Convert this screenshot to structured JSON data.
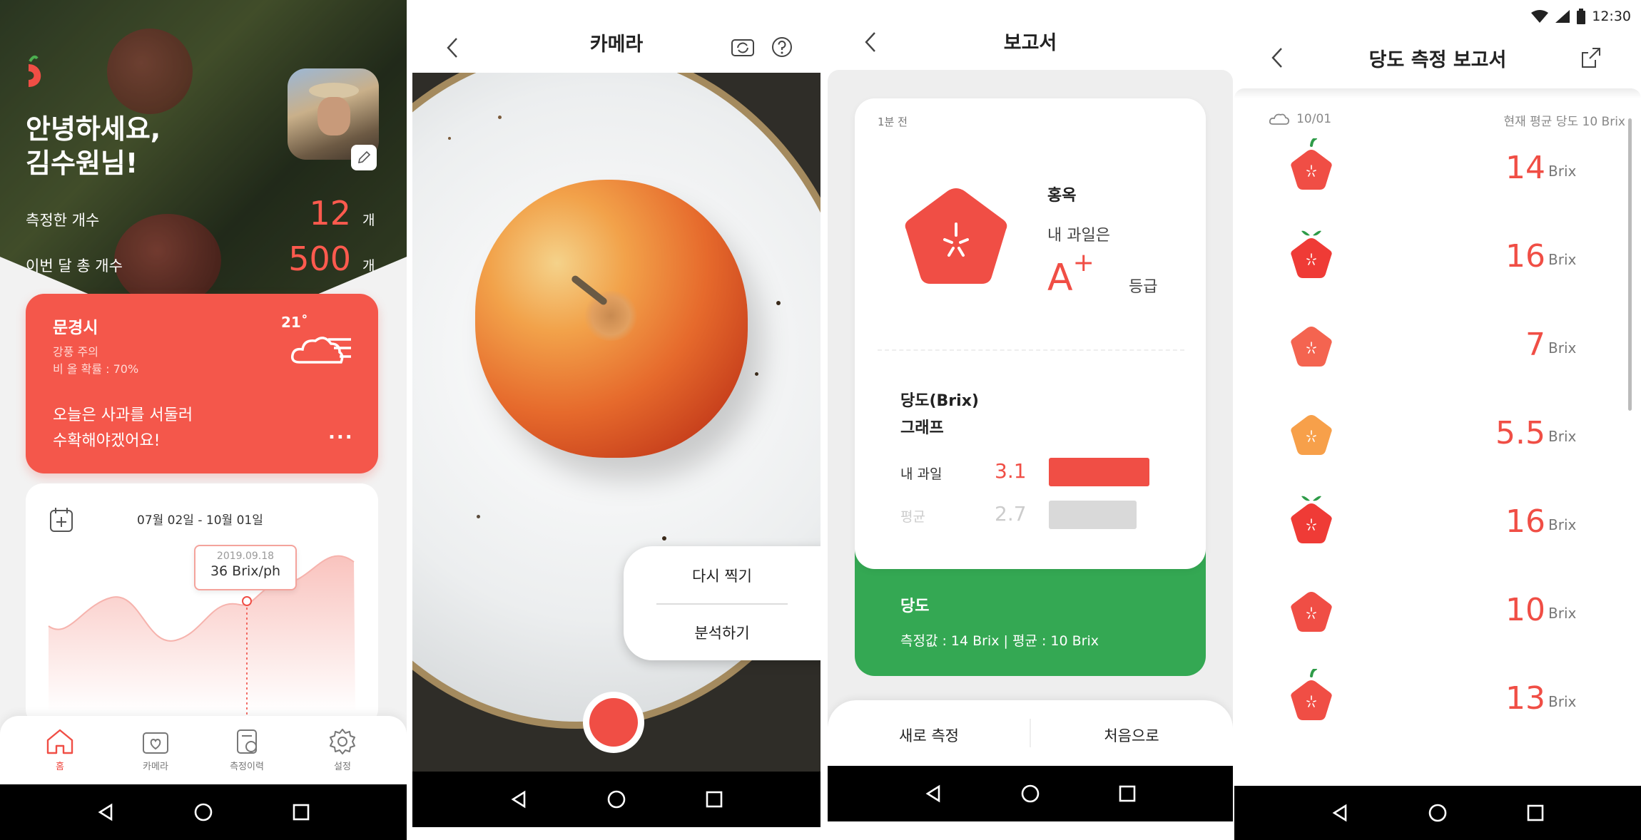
{
  "home": {
    "greeting_line1": "안녕하세요,",
    "greeting_line2": "김수원님!",
    "stats": [
      {
        "label": "측정한 개수",
        "value": "12",
        "unit": "개"
      },
      {
        "label": "이번 달 총 개수",
        "value": "500",
        "unit": "개"
      }
    ],
    "weather": {
      "city": "문경시",
      "temp": "21˚",
      "warning": "강풍 주의",
      "rain": "비 올 확률 : 70%",
      "message_line1": "오늘은 사과를 서둘러",
      "message_line2": "수확해야겠어요!",
      "more": "..."
    },
    "chart_card": {
      "date_range": "07월 02일 - 10월 01일",
      "tooltip_date": "2019.09.18",
      "tooltip_value": "36 Brix/ph"
    },
    "tabs": [
      {
        "label": "홈",
        "icon": "home-icon"
      },
      {
        "label": "카메라",
        "icon": "camera-icon"
      },
      {
        "label": "측정이력",
        "icon": "history-icon"
      },
      {
        "label": "설정",
        "icon": "gear-icon"
      }
    ]
  },
  "camera": {
    "title": "카메라",
    "retake": "다시 찍기",
    "analyze": "분석하기"
  },
  "report": {
    "title": "보고서",
    "time_ago": "1분 전",
    "variety": "홍옥",
    "my_fruit_is": "내 과일은",
    "grade": "A",
    "grade_sup": "+",
    "grade_suffix": "등급",
    "graph_title_line1": "당도(Brix)",
    "graph_title_line2": "그래프",
    "bars": [
      {
        "label": "내 과일",
        "value": 3.1,
        "value_text": "3.1",
        "color": "#f04e45"
      },
      {
        "label": "평균",
        "value": 2.7,
        "value_text": "2.7",
        "color": "#d9d9d9"
      }
    ],
    "sugar_title": "당도",
    "sugar_detail": "측정값 : 14 Brix | 평균 : 10 Brix",
    "new_measure": "새로 측정",
    "go_home": "처음으로"
  },
  "brix_report": {
    "status_time": "12:30",
    "title": "당도 측정 보고서",
    "date": "10/01",
    "avg_text": "현재 평균 당도 10 Brix",
    "items": [
      {
        "value": "14",
        "unit": "Brix",
        "color": "#f04e45",
        "leaf": "single"
      },
      {
        "value": "16",
        "unit": "Brix",
        "color": "#ef3b36",
        "leaf": "double"
      },
      {
        "value": "7",
        "unit": "Brix",
        "color": "#f46450",
        "leaf": "none"
      },
      {
        "value": "5.5",
        "unit": "Brix",
        "color": "#f7a04a",
        "leaf": "none"
      },
      {
        "value": "16",
        "unit": "Brix",
        "color": "#ef3b36",
        "leaf": "double"
      },
      {
        "value": "10",
        "unit": "Brix",
        "color": "#f04e45",
        "leaf": "none"
      },
      {
        "value": "13",
        "unit": "Brix",
        "color": "#f04e45",
        "leaf": "single"
      }
    ]
  }
}
